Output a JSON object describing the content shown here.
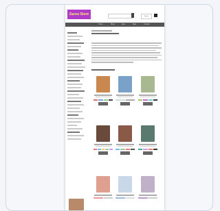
{
  "header": {
    "logo_text": "Zazou Store",
    "sign_in_label": "Sign in"
  },
  "nav": {
    "items": [
      "Home",
      "Shop",
      "New",
      "Sale",
      "Contact"
    ]
  },
  "colors": {
    "logo_bg": "#b03cc8",
    "nav_bg": "#555555",
    "button_bg": "#666666"
  },
  "products": [
    {
      "thumb_color": "#c98850"
    },
    {
      "thumb_color": "#7aa2c8"
    },
    {
      "thumb_color": "#a8b890"
    },
    {
      "thumb_color": "#6a4a3a"
    },
    {
      "thumb_color": "#8a5a48"
    },
    {
      "thumb_color": "#5a7a70"
    },
    {
      "thumb_color": "#e0a090"
    },
    {
      "thumb_color": "#c8d8e8"
    },
    {
      "thumb_color": "#c0b0c8"
    }
  ]
}
